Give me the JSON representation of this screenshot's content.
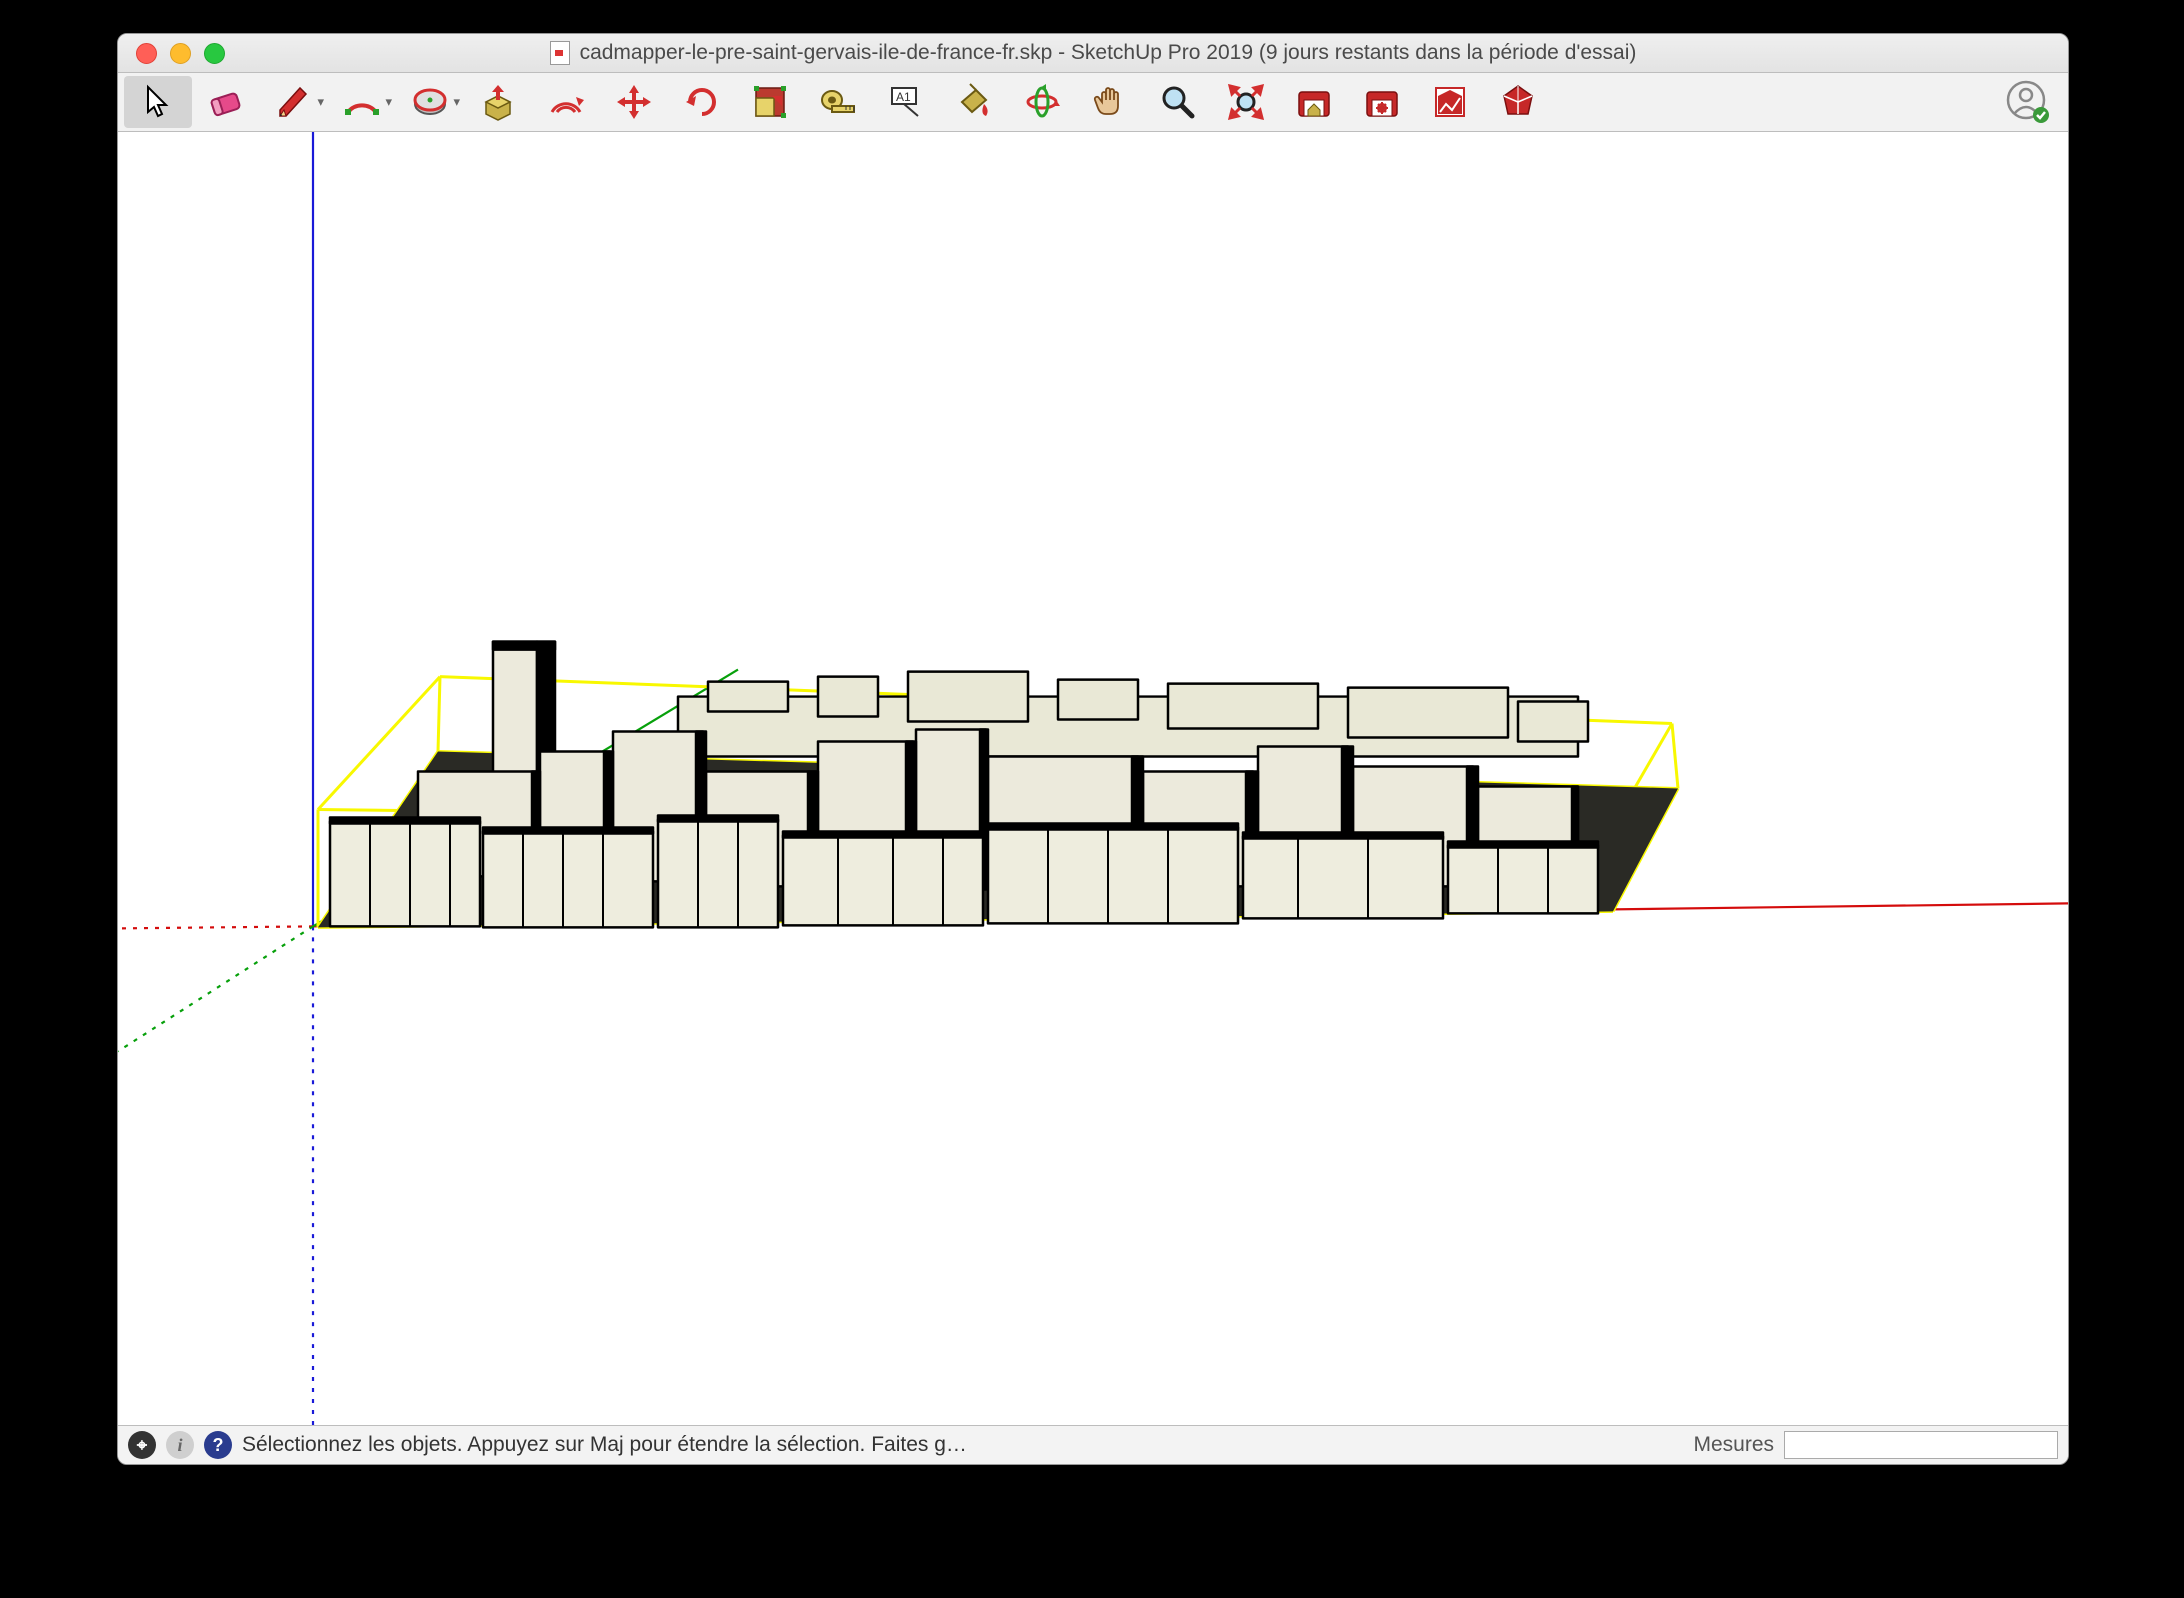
{
  "window": {
    "title": "cadmapper-le-pre-saint-gervais-ile-de-france-fr.skp - SketchUp Pro 2019 (9 jours restants dans la période d'essai)"
  },
  "toolbar": {
    "items": [
      {
        "name": "select-tool",
        "dropdown": false,
        "selected": true
      },
      {
        "name": "eraser-tool",
        "dropdown": false
      },
      {
        "name": "line-tool",
        "dropdown": true
      },
      {
        "name": "arc-tool",
        "dropdown": true
      },
      {
        "name": "shapes-tool",
        "dropdown": true
      },
      {
        "name": "push-pull-tool",
        "dropdown": false
      },
      {
        "name": "offset-tool",
        "dropdown": false
      },
      {
        "name": "move-tool",
        "dropdown": false
      },
      {
        "name": "rotate-tool",
        "dropdown": false
      },
      {
        "name": "scale-tool",
        "dropdown": false
      },
      {
        "name": "tape-measure-tool",
        "dropdown": false
      },
      {
        "name": "text-tool",
        "dropdown": false
      },
      {
        "name": "paint-bucket-tool",
        "dropdown": false
      },
      {
        "name": "orbit-tool",
        "dropdown": false
      },
      {
        "name": "pan-tool",
        "dropdown": false
      },
      {
        "name": "zoom-tool",
        "dropdown": false
      },
      {
        "name": "zoom-extents-tool",
        "dropdown": false
      },
      {
        "name": "3d-warehouse-tool",
        "dropdown": false
      },
      {
        "name": "extension-warehouse-tool",
        "dropdown": false
      },
      {
        "name": "layout-tool",
        "dropdown": false
      },
      {
        "name": "ruby-console-tool",
        "dropdown": false
      }
    ]
  },
  "statusbar": {
    "hint": "Sélectionnez les objets. Appuyez sur Maj pour étendre la sélection. Faites g…",
    "measure_label": "Mesures",
    "measure_value": ""
  }
}
